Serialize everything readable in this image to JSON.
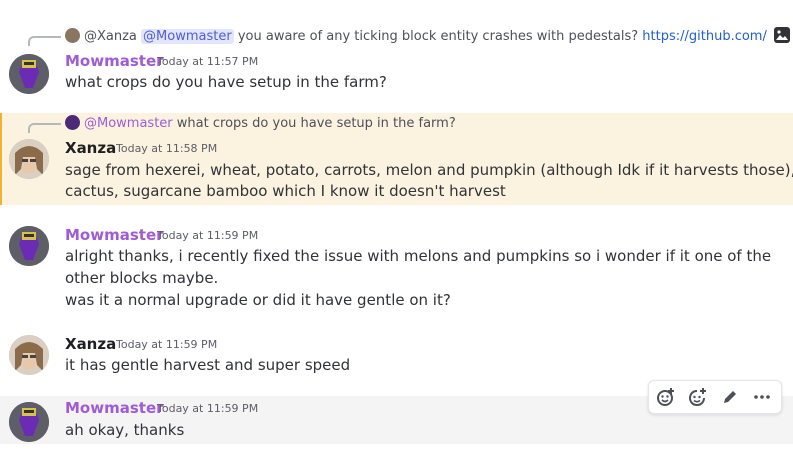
{
  "messages": [
    {
      "reply": {
        "author": "@Xanza",
        "mention": "@Mowmaster",
        "text": "you aware of any ticking block entity crashes with pedestals?",
        "link": "https://github.com/"
      },
      "author": "Mowmaster",
      "time": "Today at 11:57 PM",
      "lines": [
        "what crops do you have setup in the farm?"
      ]
    },
    {
      "reply": {
        "author": "@Mowmaster",
        "text": "what crops do you have setup in the farm?"
      },
      "author": "Xanza",
      "time": "Today at 11:58 PM",
      "lines": [
        "sage  from hexerei, wheat, potato, carrots, melon and pumpkin (although Idk if it harvests those),",
        "cactus, sugarcane bamboo which I know it doesn't harvest"
      ]
    },
    {
      "author": "Mowmaster",
      "time": "Today at 11:59 PM",
      "lines": [
        "alright thanks, i recently fixed the issue with melons and pumpkins so i wonder if it one of the",
        "other blocks maybe.",
        "was it a normal upgrade or did it have gentle on it?"
      ]
    },
    {
      "author": "Xanza",
      "time": "Today at 11:59 PM",
      "lines": [
        "it has gentle harvest and super speed"
      ]
    },
    {
      "author": "Mowmaster",
      "time": "Today at 11:59 PM",
      "lines": [
        "ah okay, thanks"
      ]
    }
  ],
  "toolbar": {
    "buttons": [
      "add-reaction-icon",
      "super-reaction-icon",
      "edit-icon",
      "more-icon"
    ]
  },
  "colors": {
    "mowmaster_name": "#a05cd5",
    "mention_bg": "#fbf3e0",
    "mention_bar": "#f0b232",
    "link": "#2060cf"
  }
}
